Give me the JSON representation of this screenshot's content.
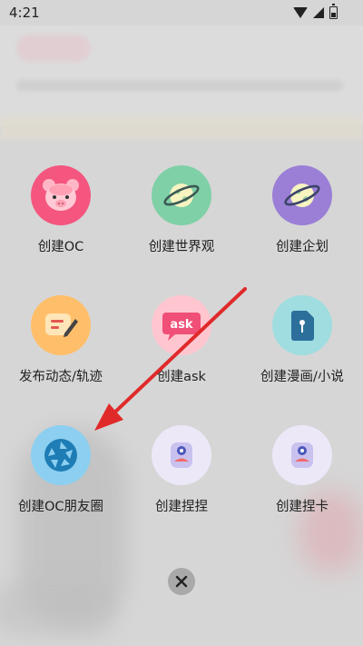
{
  "status_bar": {
    "time": "4:21"
  },
  "menu": {
    "items": [
      {
        "label": "创建OC",
        "icon": "pig-face-icon",
        "color": "#f4567f"
      },
      {
        "label": "创建世界观",
        "icon": "planet-icon",
        "color": "#7fd0a6"
      },
      {
        "label": "创建企划",
        "icon": "planet-icon",
        "color": "#9b7fd6"
      },
      {
        "label": "发布动态/轨迹",
        "icon": "edit-note-icon",
        "color": "#ffbf6a"
      },
      {
        "label": "创建ask",
        "icon": "ask-bubble-icon",
        "color": "#ffc6cf",
        "badge_text": "ask"
      },
      {
        "label": "创建漫画/小说",
        "icon": "sd-card-icon",
        "color": "#9fdde0"
      },
      {
        "label": "创建OC朋友圈",
        "icon": "camera-aperture-icon",
        "color": "#8ccff0"
      },
      {
        "label": "创建捏捏",
        "icon": "robot-face-icon",
        "color": "#ece8f8"
      },
      {
        "label": "创建捏卡",
        "icon": "robot-face-icon",
        "color": "#ece8f8"
      }
    ]
  },
  "close_button": {
    "icon": "close-icon",
    "glyph": "×"
  },
  "annotation": {
    "arrow_color": "#e02a2a"
  }
}
